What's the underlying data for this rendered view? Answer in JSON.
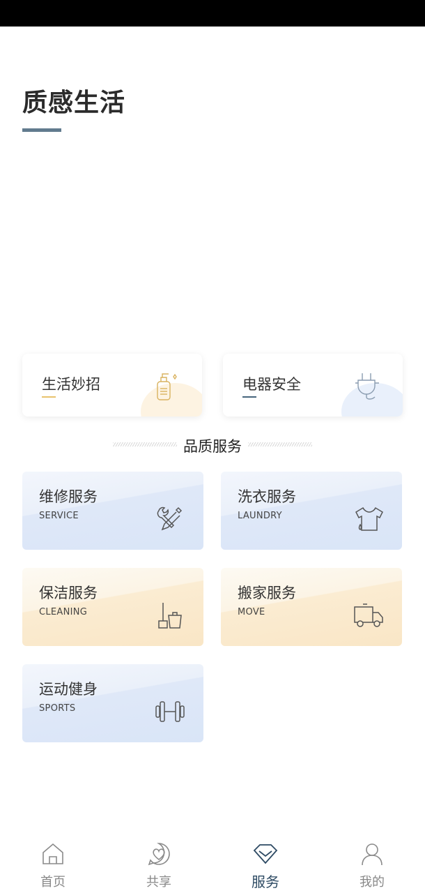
{
  "page": {
    "title": "质感生活"
  },
  "tips": [
    {
      "label": "生活妙招",
      "icon": "soap-bottle-icon",
      "accent": "#e8c26c"
    },
    {
      "label": "电器安全",
      "icon": "plug-icon",
      "accent": "#46657d"
    }
  ],
  "section": {
    "title": "品质服务"
  },
  "services": [
    {
      "name": "维修服务",
      "en": "SERVICE",
      "icon": "tools-icon",
      "theme": "blue"
    },
    {
      "name": "洗衣服务",
      "en": "LAUNDRY",
      "icon": "shirt-icon",
      "theme": "blue"
    },
    {
      "name": "保洁服务",
      "en": "CLEANING",
      "icon": "cleaning-icon",
      "theme": "yellow"
    },
    {
      "name": "搬家服务",
      "en": "MOVE",
      "icon": "truck-icon",
      "theme": "yellow"
    },
    {
      "name": "运动健身",
      "en": "SPORTS",
      "icon": "dumbbell-icon",
      "theme": "blue"
    }
  ],
  "tabbar": {
    "items": [
      {
        "label": "首页",
        "icon": "home-icon",
        "active": false
      },
      {
        "label": "共享",
        "icon": "share-heart-icon",
        "active": false
      },
      {
        "label": "服务",
        "icon": "diamond-icon",
        "active": true
      },
      {
        "label": "我的",
        "icon": "profile-icon",
        "active": false
      }
    ]
  },
  "colors": {
    "accent": "#617b8e",
    "active_tab": "#2d4a63",
    "tip_yellow": "#e8c26c",
    "tip_blue": "#46657d"
  }
}
